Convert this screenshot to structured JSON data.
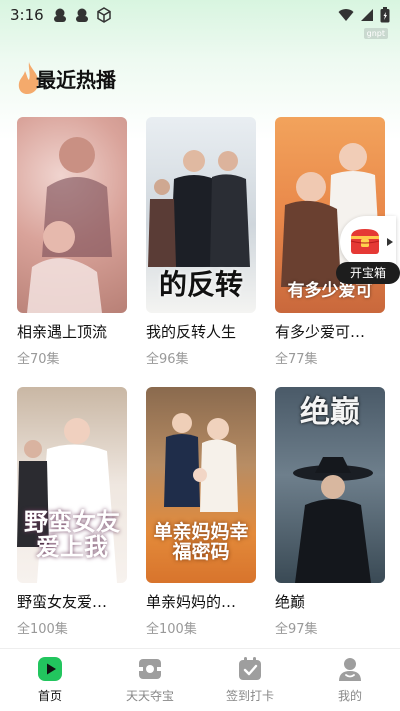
{
  "status_bar": {
    "time": "3:16",
    "tag": "gnpt"
  },
  "section": {
    "title": "最近热播"
  },
  "dramas": [
    {
      "name": "相亲遇上顶流",
      "count": "全70集",
      "art": ""
    },
    {
      "name": "我的反转人生",
      "count": "全96集",
      "art": "的反转"
    },
    {
      "name": "有多少爱可…",
      "count": "全77集",
      "art": "有多少爱可"
    },
    {
      "name": "野蛮女友爱…",
      "count": "全100集",
      "art": "野蛮女友爱上我"
    },
    {
      "name": "单亲妈妈的…",
      "count": "全100集",
      "art": "单亲妈妈幸福密码"
    },
    {
      "name": "绝巅",
      "count": "全97集",
      "art": "绝巅"
    }
  ],
  "treasure": {
    "label": "开宝箱"
  },
  "nav": [
    {
      "label": "首页",
      "icon": "play-icon"
    },
    {
      "label": "天天夺宝",
      "icon": "ticket-icon"
    },
    {
      "label": "签到打卡",
      "icon": "calendar-check-icon"
    },
    {
      "label": "我的",
      "icon": "user-icon"
    }
  ],
  "colors": {
    "accent": "#22c55e",
    "flame": "#f4a15d"
  }
}
